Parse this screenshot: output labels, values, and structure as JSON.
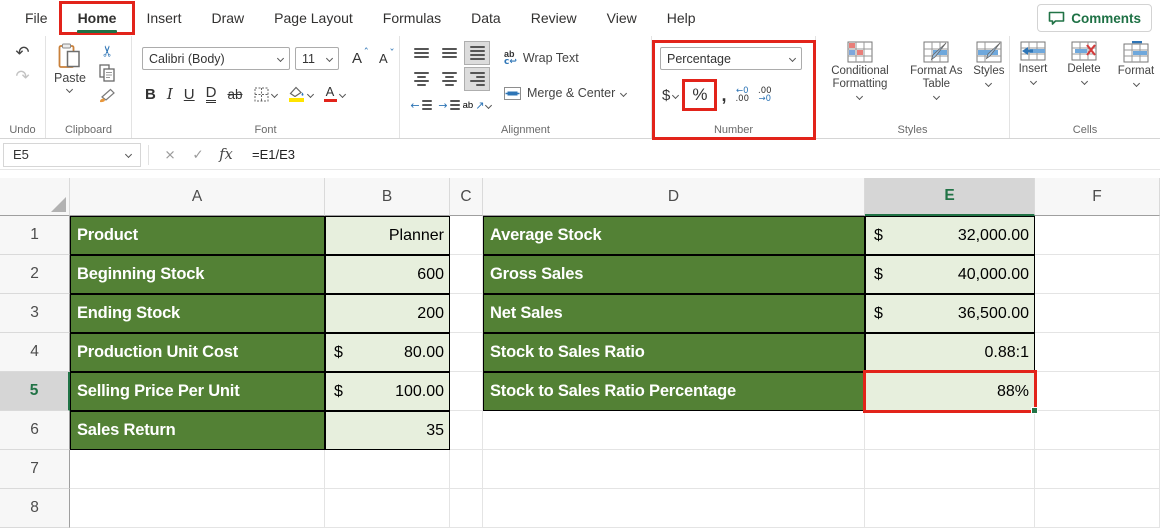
{
  "tab_bar": {
    "tabs": [
      {
        "label": "File"
      },
      {
        "label": "Home",
        "active": true,
        "annotated": true
      },
      {
        "label": "Insert"
      },
      {
        "label": "Draw"
      },
      {
        "label": "Page Layout"
      },
      {
        "label": "Formulas"
      },
      {
        "label": "Data"
      },
      {
        "label": "Review"
      },
      {
        "label": "View"
      },
      {
        "label": "Help"
      }
    ],
    "comments_label": "Comments"
  },
  "ribbon": {
    "undo": {
      "label": "Undo"
    },
    "clipboard": {
      "label": "Clipboard",
      "paste": "Paste"
    },
    "font": {
      "label": "Font",
      "name": "Calibri (Body)",
      "size": "11",
      "bold": "B",
      "italic": "I",
      "underline": "U",
      "double_underline": "D",
      "strikethrough": "ab",
      "grow": "A",
      "shrink": "A",
      "color_letter": "A"
    },
    "alignment": {
      "label": "Alignment",
      "wrap": "Wrap Text",
      "merge": "Merge & Center"
    },
    "number": {
      "label": "Number",
      "format": "Percentage",
      "dollar": "$",
      "percent": "%",
      "comma": ",",
      "inc_top": "←0",
      "inc_bot": ".00",
      "dec_top": ".00",
      "dec_bot": "→0"
    },
    "styles": {
      "label": "Styles",
      "conditional": "Conditional\nFormatting",
      "format_as_table": "Format As\nTable",
      "styles": "Styles"
    },
    "cells": {
      "label": "Cells",
      "insert": "Insert",
      "delete": "Delete",
      "format": "Format"
    }
  },
  "formula_bar": {
    "name_box": "E5",
    "formula": "=E1/E3"
  },
  "icons": {
    "undo": "↶",
    "redo": "↷",
    "cut": "✂",
    "cancel": "×",
    "enter": "✓",
    "fx": "fx",
    "grow_caret": "ˆ",
    "shrink_caret": "ˇ",
    "wrap_top": "ab",
    "wrap_bottom": "c↩",
    "orient_ab": "ab",
    "orient_arrow": "↗",
    "indent_dec": "←",
    "indent_inc": "→"
  },
  "sheet": {
    "columns": [
      "A",
      "B",
      "C",
      "D",
      "E",
      "F"
    ],
    "rows": [
      "1",
      "2",
      "3",
      "4",
      "5",
      "6",
      "7",
      "8"
    ],
    "selected_column": "E",
    "selected_row": "5",
    "selected_cell": "E5",
    "left_table": [
      {
        "label": "Product",
        "value": "Planner"
      },
      {
        "label": "Beginning Stock",
        "value": "600"
      },
      {
        "label": "Ending Stock",
        "value": "200"
      },
      {
        "label": "Production Unit Cost",
        "currency": "$",
        "value": "80.00"
      },
      {
        "label": "Selling Price Per Unit",
        "currency": "$",
        "value": "100.00"
      },
      {
        "label": "Sales Return",
        "value": "35"
      }
    ],
    "right_table": [
      {
        "label": "Average Stock",
        "currency": "$",
        "value": "32,000.00"
      },
      {
        "label": "Gross Sales",
        "currency": "$",
        "value": "40,000.00"
      },
      {
        "label": "Net Sales",
        "currency": "$",
        "value": "36,500.00"
      },
      {
        "label": "Stock to Sales Ratio",
        "value": "0.88:1"
      },
      {
        "label": "Stock to Sales Ratio Percentage",
        "value": "88%",
        "annotated": true
      }
    ]
  },
  "colors": {
    "table_header_green": "#538135",
    "table_cell_green": "#E7EFDD",
    "excel_green": "#217346",
    "annotation_red": "#E2231A",
    "selected_header_gray": "#D6D6D6"
  }
}
